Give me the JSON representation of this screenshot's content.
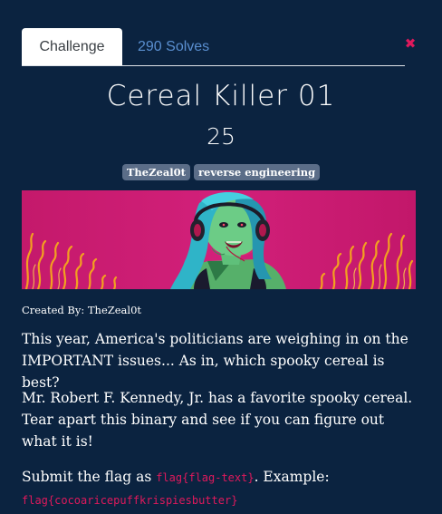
{
  "tabs": {
    "challenge_label": "Challenge",
    "solves_label": "290 Solves"
  },
  "close_symbol": "✖",
  "challenge": {
    "name": "Cereal Killer 01",
    "points": "25",
    "tags": [
      "TheZeal0t",
      "reverse engineering"
    ],
    "created_by": "Created By: TheZeal0t",
    "description_1": "This year, America's politicians are weighing in on the IMPORTANT issues... As in, which spooky cereal is best?",
    "description_2": "Mr. Robert F. Kennedy, Jr. has a favorite spooky cereal. Tear apart this binary and see if you can figure out what it is!",
    "submit_prefix": "Submit the flag as ",
    "flag_format": "flag{flag-text}",
    "example_label": ". Example:",
    "example_flag": "flag{cocoaricepuffkrispiesbutter}"
  },
  "colors": {
    "background": "#0b2340",
    "accent": "#e0195c",
    "link": "#5a8fd0",
    "badge": "#5b6d88"
  },
  "icons": {
    "close": "close-icon"
  }
}
